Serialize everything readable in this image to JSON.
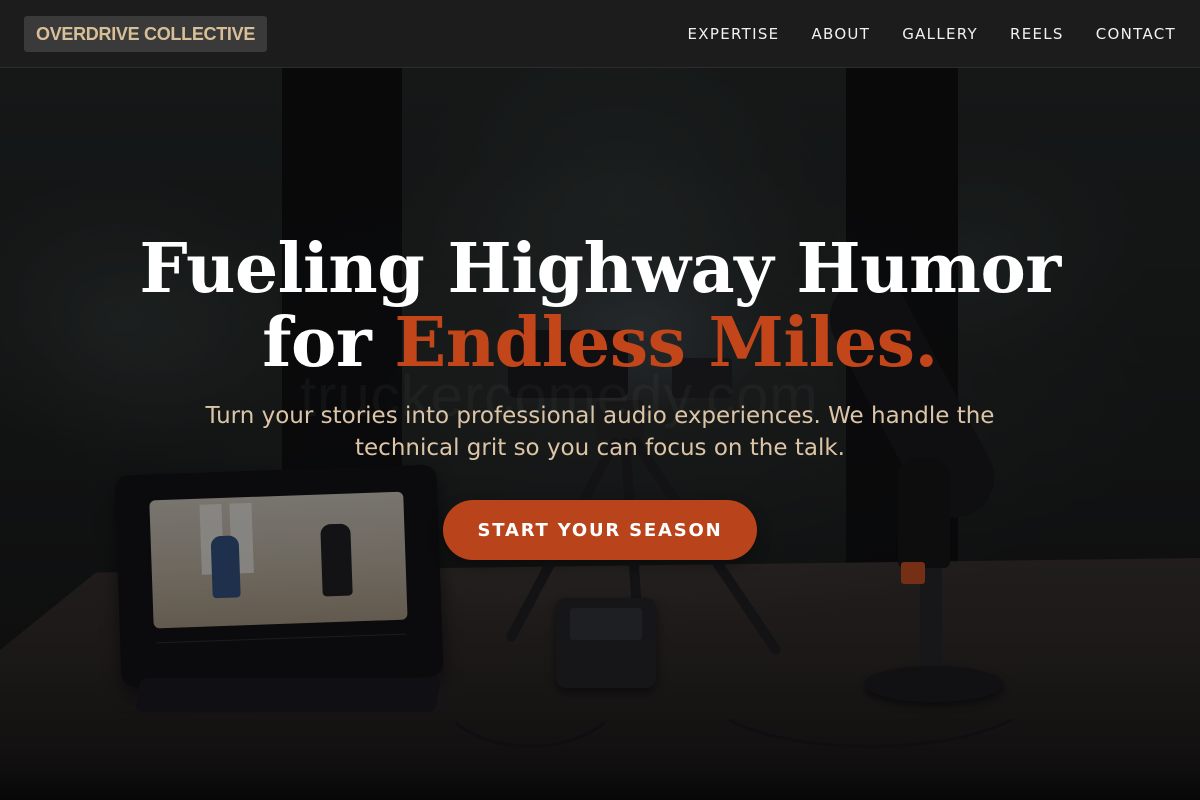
{
  "navbar": {
    "brand": "OVERDRIVE COLLECTIVE",
    "links": [
      "EXPERTISE",
      "ABOUT",
      "GALLERY",
      "REELS",
      "CONTACT"
    ]
  },
  "hero": {
    "headline_line1": "Fueling Highway Humor",
    "headline_for": "for",
    "headline_accent": "Endless Miles.",
    "subheadline": "Turn your stories into professional audio experiences. We handle the technical grit so you can focus on the talk.",
    "cta_label": "START YOUR SEASON",
    "background_watermark": "truckercomedy.com"
  },
  "colors": {
    "accent": "#c2461a",
    "brand_text": "#d8bf98",
    "subheadline_text": "#dcc5a6",
    "cta_background": "#b9431a"
  }
}
